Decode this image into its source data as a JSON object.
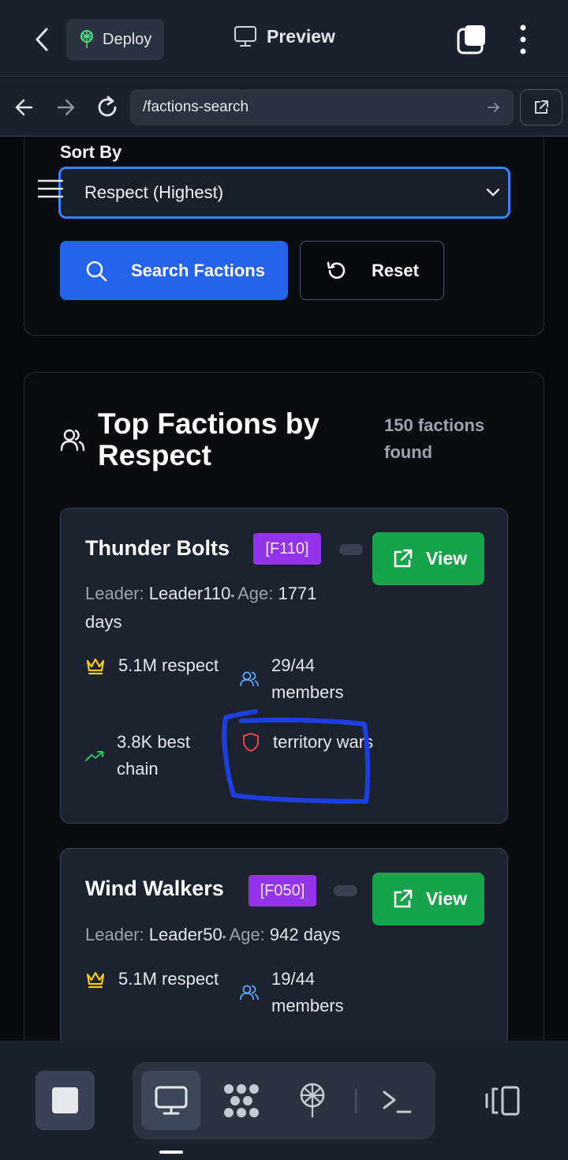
{
  "topbar": {
    "deploy_label": "Deploy",
    "preview_label": "Preview"
  },
  "urlbar": {
    "url": "/factions-search"
  },
  "filters": {
    "sort_label": "Sort By",
    "sort_value": "Respect (Highest)",
    "search_button": "Search Factions",
    "reset_button": "Reset"
  },
  "results": {
    "title": "Top Factions by Respect",
    "count_text": "150 factions found",
    "factions": [
      {
        "name": "Thunder Bolts",
        "tag": "[F110]",
        "view_label": "View",
        "leader_label": "Leader:",
        "leader": "Leader110",
        "age_label": "Age:",
        "age": "1771 days",
        "respect": "5.1M respect",
        "members": "29/44 members",
        "best_chain": "3.8K best chain",
        "wars": "territory wars"
      },
      {
        "name": "Wind Walkers",
        "tag": "[F050]",
        "view_label": "View",
        "leader_label": "Leader:",
        "leader": "Leader50",
        "age_label": "Age:",
        "age": "942 days",
        "respect": "5.1M respect",
        "members": "19/44 members"
      }
    ]
  },
  "colors": {
    "accent_blue": "#2563eb",
    "view_green": "#16a34a",
    "tag_purple": "#9333ea",
    "annotation_blue": "#1d3fe0"
  }
}
